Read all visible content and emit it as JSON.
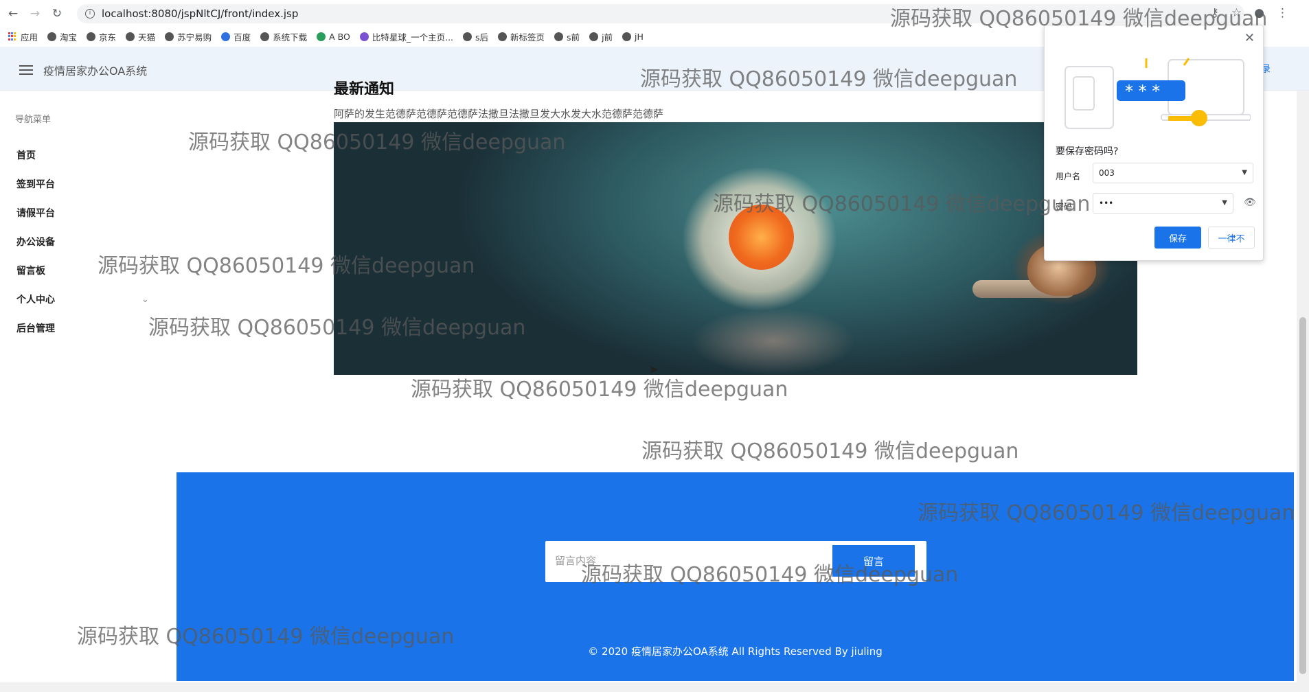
{
  "browser": {
    "url": "localhost:8080/jspNltCJ/front/index.jsp",
    "bookmarks": [
      "应用",
      "淘宝",
      "京东",
      "天猫",
      "苏宁易购",
      "百度",
      "系统下载",
      "A BO",
      "比特星球_一个主页...",
      "s后",
      "新标签页",
      "s前",
      "j前",
      "jH"
    ]
  },
  "header": {
    "title": "疫情居家办公OA系统",
    "right_link": "录"
  },
  "sidebar": {
    "caption": "导航菜单",
    "items": [
      {
        "label": "首页"
      },
      {
        "label": "签到平台"
      },
      {
        "label": "请假平台"
      },
      {
        "label": "办公设备"
      },
      {
        "label": "留言板"
      },
      {
        "label": "个人中心"
      },
      {
        "label": "后台管理"
      }
    ]
  },
  "article": {
    "heading": "最新通知",
    "description": "阿萨的发生范德萨范德萨范德萨法撒旦法撒旦发大水发大水范德萨范德萨"
  },
  "message_board": {
    "placeholder": "留言内容",
    "submit_label": "留言",
    "copyright": "© 2020 疫情居家办公OA系统 All Rights Reserved By jiuling"
  },
  "password_popup": {
    "title": "要保存密码吗?",
    "username_label": "用户名",
    "username_value": "003",
    "password_label": "密码",
    "password_value": "•••",
    "save_label": "保存",
    "never_label": "一律不"
  },
  "watermark": "源码获取 QQ86050149 微信deepguan"
}
